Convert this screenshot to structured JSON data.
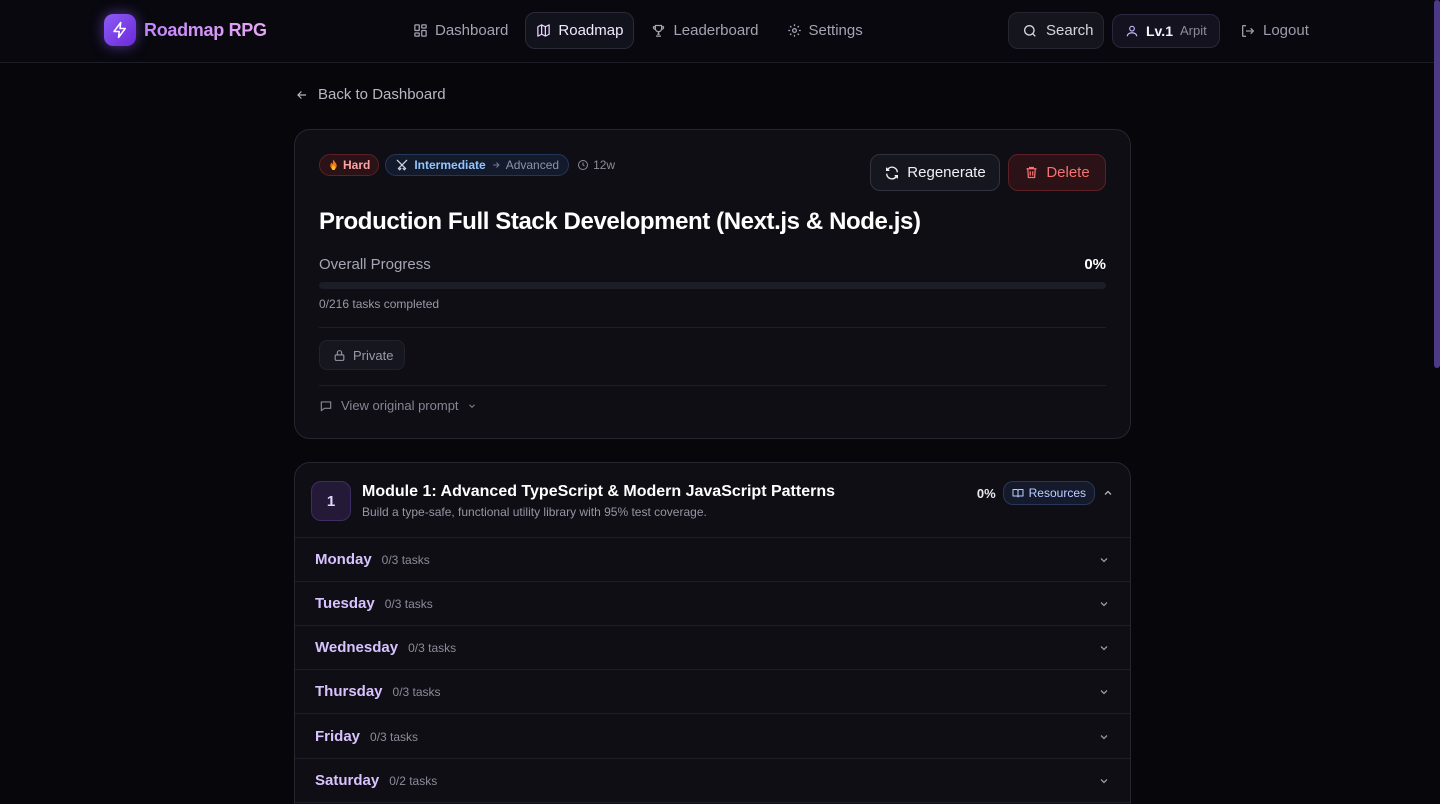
{
  "app": {
    "name": "Roadmap RPG"
  },
  "nav": {
    "items": [
      {
        "label": "Dashboard",
        "icon": "dashboard-icon"
      },
      {
        "label": "Roadmap",
        "icon": "map-icon",
        "active": true
      },
      {
        "label": "Leaderboard",
        "icon": "trophy-icon"
      },
      {
        "label": "Settings",
        "icon": "gear-icon"
      }
    ],
    "search_label": "Search",
    "user": {
      "level": "Lv.1",
      "name": "Arpit"
    },
    "logout_label": "Logout"
  },
  "back_label": "Back to Dashboard",
  "roadmap": {
    "difficulty": "Hard",
    "level_from": "Intermediate",
    "level_to": "Advanced",
    "duration": "12w",
    "regenerate_label": "Regenerate",
    "delete_label": "Delete",
    "title": "Production Full Stack Development (Next.js & Node.js)",
    "progress_label": "Overall Progress",
    "progress_percent": "0%",
    "progress_value": 0,
    "tasks_completed": "0/216 tasks completed",
    "visibility": "Private",
    "prompt_label": "View original prompt"
  },
  "module": {
    "number": "1",
    "title": "Module 1: Advanced TypeScript & Modern JavaScript Patterns",
    "subtitle": "Build a type-safe, functional utility library with 95% test coverage.",
    "percent": "0%",
    "resources_label": "Resources",
    "days": [
      {
        "name": "Monday",
        "tasks": "0/3 tasks"
      },
      {
        "name": "Tuesday",
        "tasks": "0/3 tasks"
      },
      {
        "name": "Wednesday",
        "tasks": "0/3 tasks"
      },
      {
        "name": "Thursday",
        "tasks": "0/3 tasks"
      },
      {
        "name": "Friday",
        "tasks": "0/3 tasks"
      },
      {
        "name": "Saturday",
        "tasks": "0/2 tasks"
      }
    ]
  },
  "colors": {
    "accent": "#8b5cf6",
    "danger": "#f87171",
    "background": "#06060b"
  }
}
